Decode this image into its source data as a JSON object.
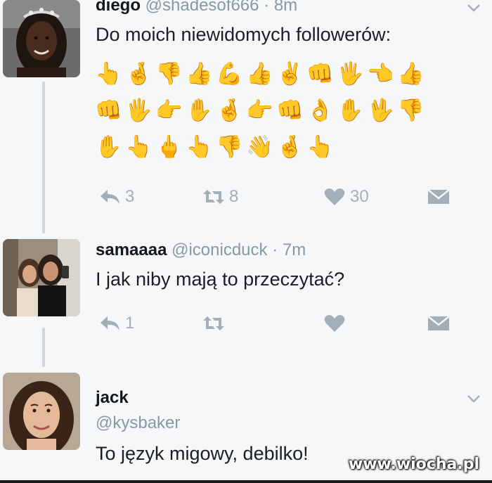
{
  "tweets": [
    {
      "name": "diego",
      "handle": "@shadesof666",
      "separator": "·",
      "time": "8m",
      "text": "Do moich niewidomych followerów:",
      "emoji_rows": [
        [
          "👆",
          "🤞",
          "👎",
          "👍",
          "💪",
          "👍",
          "✌",
          "👊",
          "🖐",
          "👈",
          "👍"
        ],
        [
          "👊",
          "🖐",
          "👉",
          "✋",
          "🤞",
          "👉",
          "👊",
          "👌",
          "✋",
          "🖖",
          "👎"
        ],
        [
          "✋",
          "👆",
          "🖕",
          "👆",
          "👎",
          "👋",
          "🤞",
          "👆"
        ]
      ],
      "actions": {
        "reply_count": "3",
        "retweet_count": "8",
        "like_count": "30"
      },
      "avatar_icon": "profile-photo",
      "chevron_icon": "chevron-down"
    },
    {
      "name": "samaaaa",
      "handle": "@iconicduck",
      "separator": "·",
      "time": "7m",
      "text": "I jak niby mają to przeczytać?",
      "actions": {
        "reply_count": "1"
      },
      "avatar_icon": "profile-photo"
    },
    {
      "name": "jack",
      "handle": "@kysbaker",
      "text": "To język migowy, debilko!",
      "avatar_icon": "profile-photo",
      "chevron_icon": "chevron-down"
    }
  ],
  "watermark": "www.wiocha.pl",
  "colors": {
    "background": "#f5f7f8",
    "muted": "#8899a6",
    "icon": "#a2afb9",
    "thread_line": "#cfd6dc",
    "skin": "#e7b48f"
  }
}
